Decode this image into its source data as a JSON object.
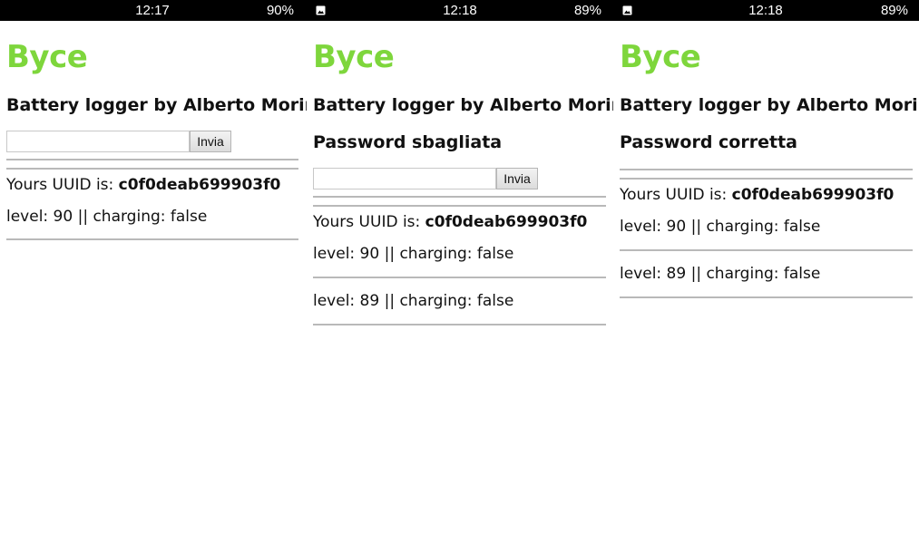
{
  "app": {
    "title": "Byce",
    "subtitle": "Battery logger by Alberto Morini",
    "submit_label": "Invia",
    "uuid_label": "Yours UUID is: ",
    "uuid_value": "c0f0deab699903f0"
  },
  "colors": {
    "title": "#7ed63c",
    "statusbar": "#000000",
    "divider": "#b9b9b9"
  },
  "screens": [
    {
      "status": {
        "time": "12:17",
        "battery": "90%",
        "notification_icon": null
      },
      "message": null,
      "logs": [
        "level: 90 || charging: false"
      ]
    },
    {
      "status": {
        "time": "12:18",
        "battery": "89%",
        "notification_icon": "image-icon"
      },
      "message": "Password sbagliata",
      "logs": [
        "level: 90 || charging: false",
        "level: 89 || charging: false"
      ]
    },
    {
      "status": {
        "time": "12:18",
        "battery": "89%",
        "notification_icon": "image-icon"
      },
      "message": "Password corretta",
      "logs": [
        "level: 90 || charging: false",
        "level: 89 || charging: false"
      ]
    }
  ]
}
